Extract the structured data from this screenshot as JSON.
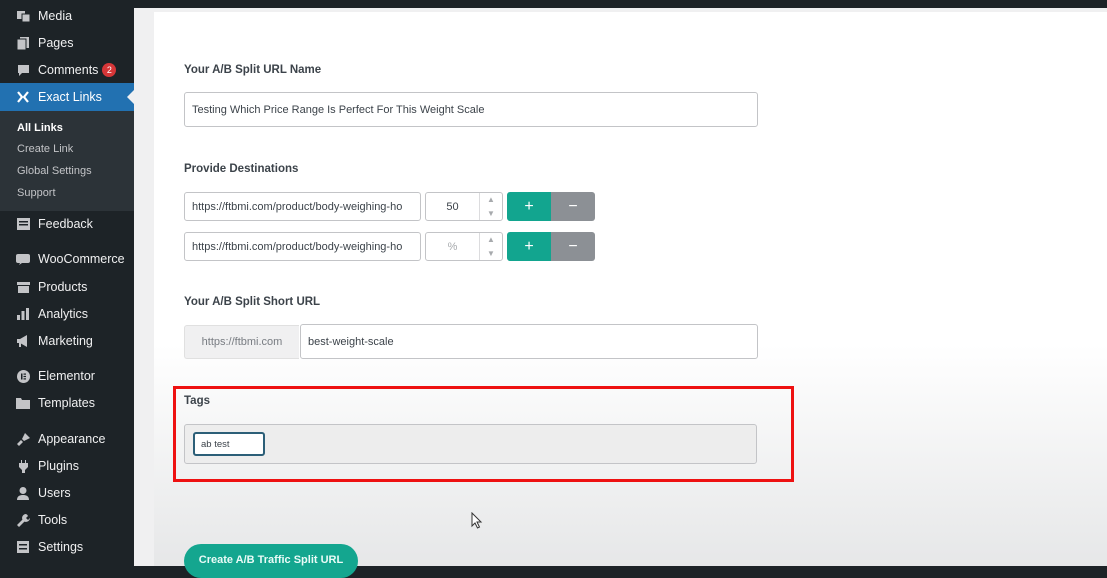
{
  "sidebar": {
    "items": [
      {
        "label": "Media",
        "icon": "media-icon"
      },
      {
        "label": "Pages",
        "icon": "pages-icon"
      },
      {
        "label": "Comments",
        "icon": "comments-icon",
        "badge": "2"
      },
      {
        "label": "Exact Links",
        "icon": "exact-links-icon"
      },
      {
        "label": "Feedback",
        "icon": "feedback-icon"
      },
      {
        "label": "WooCommerce",
        "icon": "woocommerce-icon"
      },
      {
        "label": "Products",
        "icon": "products-icon"
      },
      {
        "label": "Analytics",
        "icon": "analytics-icon"
      },
      {
        "label": "Marketing",
        "icon": "marketing-icon"
      },
      {
        "label": "Elementor",
        "icon": "elementor-icon"
      },
      {
        "label": "Templates",
        "icon": "templates-icon"
      },
      {
        "label": "Appearance",
        "icon": "appearance-icon"
      },
      {
        "label": "Plugins",
        "icon": "plugins-icon"
      },
      {
        "label": "Users",
        "icon": "users-icon"
      },
      {
        "label": "Tools",
        "icon": "tools-icon"
      },
      {
        "label": "Settings",
        "icon": "settings-icon"
      }
    ],
    "submenu": [
      {
        "label": "All Links"
      },
      {
        "label": "Create Link"
      },
      {
        "label": "Global Settings"
      },
      {
        "label": "Support"
      }
    ]
  },
  "form": {
    "name_label": "Your A/B Split URL Name",
    "name_value": "Testing Which Price Range Is Perfect For This Weight Scale",
    "destinations_label": "Provide Destinations",
    "destinations": [
      {
        "url": "https://ftbmi.com/product/body-weighing-ho",
        "weight": "50"
      },
      {
        "url": "https://ftbmi.com/product/body-weighing-ho",
        "weight_placeholder": "%"
      }
    ],
    "plus_label": "+",
    "minus_label": "−",
    "short_url_label": "Your A/B Split Short URL",
    "short_url_prefix": "https://ftbmi.com",
    "short_url_slug": "best-weight-scale",
    "tags_label": "Tags",
    "tags": [
      "ab test"
    ],
    "submit_label": "Create A/B Traffic Split URL"
  },
  "colors": {
    "accent": "#2271b1",
    "button_teal": "#12a58f",
    "highlight_red": "#ee1111"
  }
}
